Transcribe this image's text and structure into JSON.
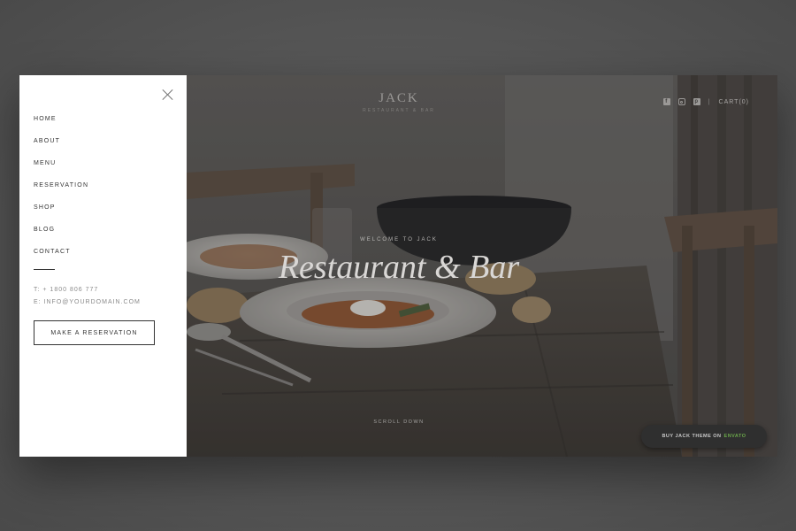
{
  "menu": {
    "items": [
      {
        "label": "HOME"
      },
      {
        "label": "ABOUT"
      },
      {
        "label": "MENU"
      },
      {
        "label": "RESERVATION"
      },
      {
        "label": "SHOP"
      },
      {
        "label": "BLOG"
      },
      {
        "label": "CONTACT"
      }
    ],
    "phone": "T: + 1800 806 777",
    "email": "E: INFO@YOURDOMAIN.COM",
    "reserve_button": "MAKE A RESERVATION",
    "close_icon": "close-icon"
  },
  "header": {
    "logo_title": "JACK",
    "logo_subtitle": "RESTAURANT & BAR",
    "social_icons": [
      "facebook-icon",
      "instagram-icon",
      "pinterest-icon"
    ],
    "separator": "|",
    "cart": "CART(0)"
  },
  "hero": {
    "eyebrow": "WELCOME TO JACK",
    "title": "Restaurant & Bar",
    "scroll_down": "SCROLL DOWN"
  },
  "promo": {
    "label": "BUY JACK THEME ON",
    "accent": "ENVATO",
    "accent_color": "#6aa64a"
  }
}
